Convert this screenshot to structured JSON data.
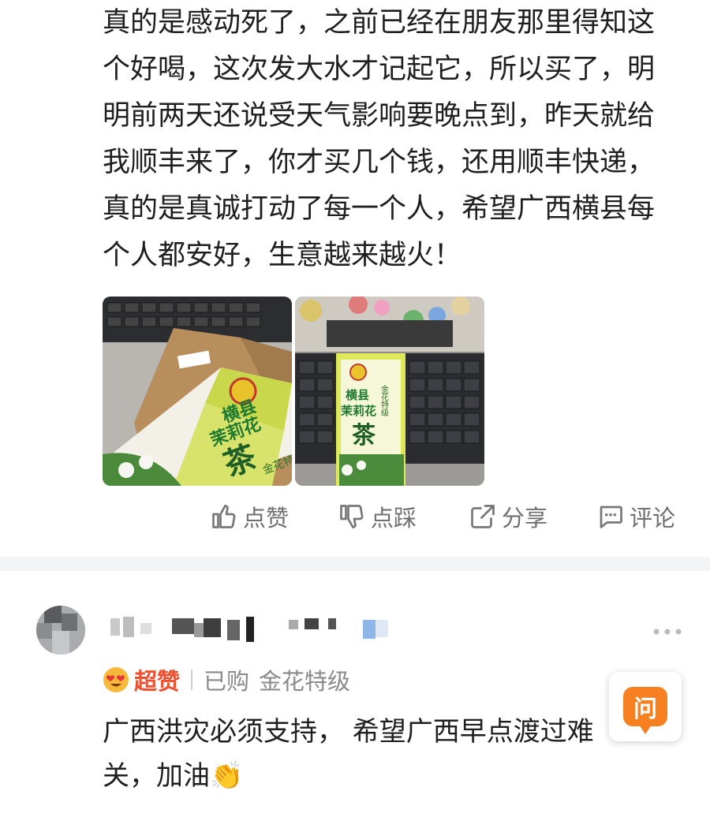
{
  "review": {
    "lines": [
      "真的是感动死了，之前已经在朋友那里得知这",
      "个好喝，这次发大水才记起它，所以买了，明",
      "明前两天还说受天气影响要晚点到，昨天就给",
      "我顺丰来了，你才买几个钱，还用顺丰快递，",
      "真的是真诚打动了每一个人，希望广西横县每",
      "个人都安好，生意越来越火！"
    ],
    "photos": [
      {
        "product_brand": "横县",
        "product_name": "茉莉花",
        "product_type": "茶",
        "product_grade": "金花特级"
      },
      {
        "product_brand": "横县",
        "product_name": "茉莉花",
        "product_type": "茶",
        "product_grade": "金花特级"
      }
    ]
  },
  "actions": {
    "like": "点赞",
    "dislike": "点踩",
    "share": "分享",
    "comment": "评论"
  },
  "reply": {
    "badge": "超赞",
    "bought": "已购",
    "spec": "金花特级",
    "lines": [
      "广西洪灾必须支持， 希望广西早点渡过难",
      "关，加油👏"
    ]
  },
  "ask_fab": {
    "label": "问"
  },
  "colors": {
    "accent": "#ef5030",
    "ask_orange": "#f6801f",
    "muted": "#8a8a8a",
    "divider": "#f3f4f6"
  }
}
